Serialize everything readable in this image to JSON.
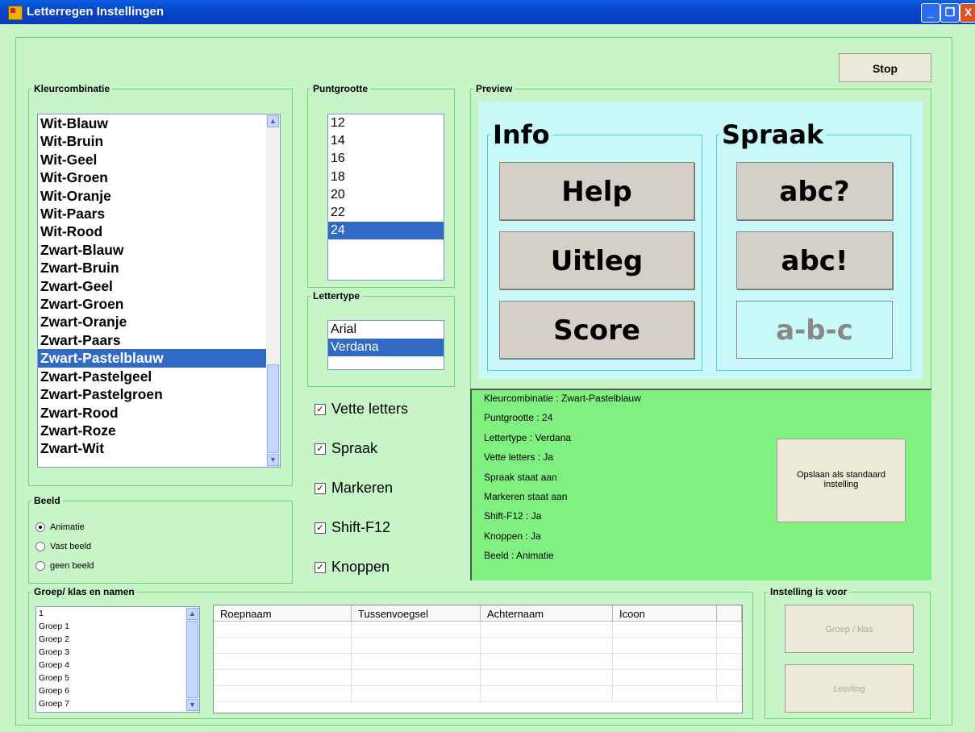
{
  "window": {
    "title": "Letterregen Instellingen",
    "minimize": "_",
    "maximize": "❐",
    "close": "X"
  },
  "stop_label": "Stop",
  "kleur": {
    "legend": "Kleurcombinatie",
    "items": [
      "Wit-Blauw",
      "Wit-Bruin",
      "Wit-Geel",
      "Wit-Groen",
      "Wit-Oranje",
      "Wit-Paars",
      "Wit-Rood",
      "Zwart-Blauw",
      "Zwart-Bruin",
      "Zwart-Geel",
      "Zwart-Groen",
      "Zwart-Oranje",
      "Zwart-Paars",
      "Zwart-Pastelblauw",
      "Zwart-Pastelgeel",
      "Zwart-Pastelgroen",
      "Zwart-Rood",
      "Zwart-Roze",
      "Zwart-Wit"
    ],
    "selected": "Zwart-Pastelblauw"
  },
  "punt": {
    "legend": "Puntgrootte",
    "items": [
      "12",
      "14",
      "16",
      "18",
      "20",
      "22",
      "24"
    ],
    "selected": "24"
  },
  "lettertype": {
    "legend": "Lettertype",
    "items": [
      "Arial",
      "Verdana"
    ],
    "selected": "Verdana"
  },
  "checks": [
    {
      "label": "Vette letters",
      "checked": true
    },
    {
      "label": "Spraak",
      "checked": true
    },
    {
      "label": "Markeren",
      "checked": true
    },
    {
      "label": "Shift-F12",
      "checked": true
    },
    {
      "label": "Knoppen",
      "checked": true
    }
  ],
  "beeld": {
    "legend": "Beeld",
    "options": [
      "Animatie",
      "Vast beeld",
      "geen beeld"
    ],
    "selected": "Animatie"
  },
  "preview": {
    "legend": "Preview",
    "info_title": "Info",
    "spraak_title": "Spraak",
    "help": "Help",
    "uitleg": "Uitleg",
    "score": "Score",
    "abcq": "abc?",
    "abce": "abc!",
    "abcd": "a-b-c"
  },
  "summary": [
    "Kleurcombinatie : Zwart-Pastelblauw",
    "Puntgrootte : 24",
    "Lettertype : Verdana",
    "Vette letters : Ja",
    "Spraak staat aan",
    "Markeren staat aan",
    "Shift-F12 : Ja",
    "Knoppen : Ja",
    "Beeld : Animatie"
  ],
  "save_label": "Opslaan als standaard instelling",
  "groep": {
    "legend": "Groep/ klas en namen",
    "items": [
      "1",
      "Groep 1",
      "Groep 2",
      "Groep 3",
      "Groep 4",
      "Groep 5",
      "Groep 6",
      "Groep 7"
    ],
    "columns": [
      "Roepnaam",
      "Tussenvoegsel",
      "Achternaam",
      "Icoon"
    ]
  },
  "instelling": {
    "legend": "Instelling is voor",
    "groep_klas": "Groep / klas",
    "leerling": "Leerling"
  },
  "colors": {
    "panel_bg": "#c8f5c8",
    "preview_bg": "#c8f8f8",
    "summary_bg": "#80f080",
    "selection": "#316ac5"
  }
}
